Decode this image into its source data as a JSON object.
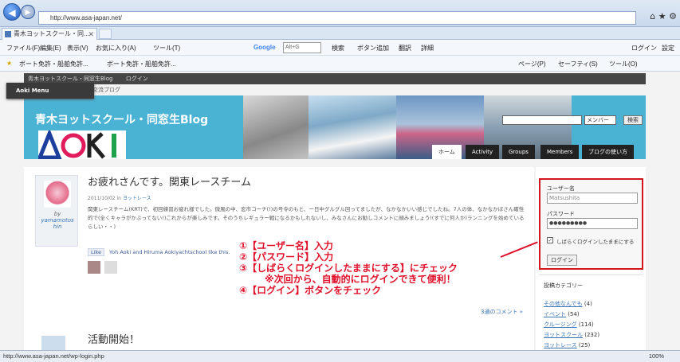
{
  "browser": {
    "address": "http://www.asa-japan.net/",
    "tab_title": "青木ヨットスクール・同...",
    "menus": [
      "ファイル(F)",
      "編集(E)",
      "表示(V)",
      "お気に入り(A)",
      "ツール(T)"
    ],
    "google_search_placeholder": "Alt+G",
    "toolbar_items": [
      "検索",
      "ボタン追加",
      "翻訳",
      "詳細"
    ],
    "login_label": "ログイン",
    "settings_label": "設定",
    "favorites": [
      "ボート免許・船舶免許...",
      "ボート免許・船舶免許..."
    ],
    "command_items": [
      "ページ(P)",
      "セーフティ(S)",
      "ツール(O)"
    ],
    "status_url": "http://www.asa-japan.net/wp-login.php",
    "zoom": "100%"
  },
  "site": {
    "admin_bar": [
      "青木ヨットスクール・同窓生Blog",
      "ログイン"
    ],
    "subtitle": "青木ヨットスクール同窓生交流ブログ",
    "blog_title": "青木ヨットスクール・同窓生Blog",
    "logo_text": "AOKI",
    "search_member_option": "メンバー",
    "search_button": "検索",
    "nav_tabs": [
      "ホーム",
      "Activity",
      "Groups",
      "Members",
      "ブログの使い方"
    ],
    "menu_tab": "Aoki Menu"
  },
  "post": {
    "title": "お疲れさんです。関東レースチーム",
    "date": "2011/10/02",
    "date_in": "in",
    "category": "ヨットレース",
    "by": "by",
    "author": "yamamotos hin",
    "excerpt": "関東レースチーム(KRT)で、初回練習お疲れ様でした。微風の中、宏市コーチ(!)の号令のもと、一日中グルグル回ってましたが、なかなかいい感じでしたね。7人の体、なかなかぼさん確性的で(全くキャラがかぶってない!)これからが楽しみです。そのうちレギュラー戦になるかもしれないし、みなさんにお勧しコメントに顔みましょう!(すでに何人か)ランニングを始めているらしい・・)",
    "like_label": "Like",
    "like_text": "Yoh Aoki and Hiruma Aokiyachtschool like this.",
    "comments_link": "3通のコメント »",
    "next_title": "活動開始！"
  },
  "annotations": [
    "①【ユーザー名】入力",
    "②【パスワード】入力",
    "③【しばらくログインしたままにする】にチェック",
    "※次回から、自動的にログインできて便利！",
    "④【ログイン】ボタンをチェック"
  ],
  "login": {
    "username_label": "ユーザー名",
    "username_value": "Matsushita",
    "password_label": "パスワード",
    "password_value": "●●●●●●●●●",
    "remember_label": "しばらくログインしたままにする",
    "remember_checked": true,
    "button": "ログイン"
  },
  "categories": {
    "title": "投稿カテゴリー",
    "items": [
      {
        "name": "その他なんでも",
        "count": "(4)"
      },
      {
        "name": "イベント",
        "count": "(54)"
      },
      {
        "name": "クルージング",
        "count": "(114)"
      },
      {
        "name": "ヨットスクール",
        "count": "(232)"
      },
      {
        "name": "ヨットレース",
        "count": "(25)"
      }
    ]
  },
  "colors": {
    "header_bg": "#4ab3d4",
    "annotation": "#e0102a",
    "login_border": "#d4141c"
  }
}
